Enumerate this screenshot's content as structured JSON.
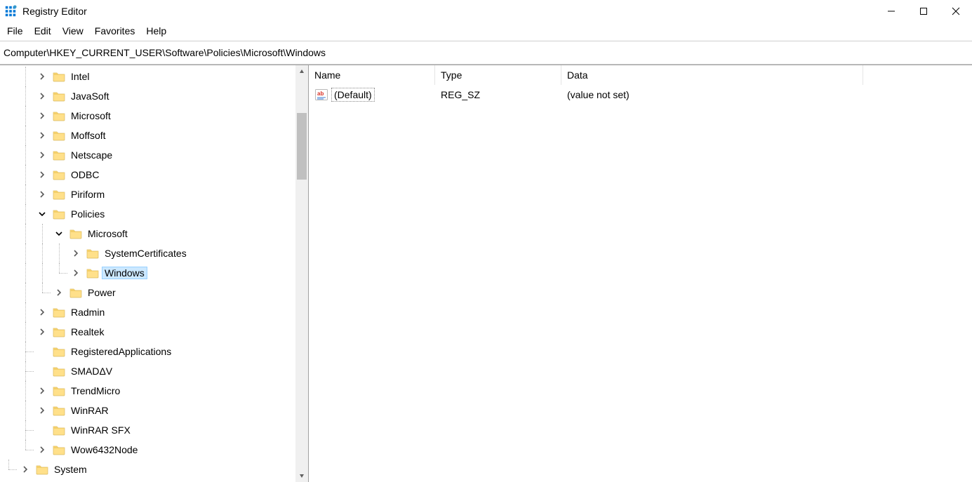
{
  "window": {
    "title": "Registry Editor"
  },
  "menu": {
    "items": [
      "File",
      "Edit",
      "View",
      "Favorites",
      "Help"
    ]
  },
  "address": {
    "path": "Computer\\HKEY_CURRENT_USER\\Software\\Policies\\Microsoft\\Windows"
  },
  "tree": {
    "items": [
      {
        "label": "Intel",
        "depth": 2,
        "glyph": "collapsed",
        "selected": false,
        "guides": [
          "blank",
          "vline"
        ],
        "last": false
      },
      {
        "label": "JavaSoft",
        "depth": 2,
        "glyph": "collapsed",
        "selected": false,
        "guides": [
          "blank",
          "vline"
        ],
        "last": false
      },
      {
        "label": "Microsoft",
        "depth": 2,
        "glyph": "collapsed",
        "selected": false,
        "guides": [
          "blank",
          "vline"
        ],
        "last": false
      },
      {
        "label": "Moffsoft",
        "depth": 2,
        "glyph": "collapsed",
        "selected": false,
        "guides": [
          "blank",
          "vline"
        ],
        "last": false
      },
      {
        "label": "Netscape",
        "depth": 2,
        "glyph": "collapsed",
        "selected": false,
        "guides": [
          "blank",
          "vline"
        ],
        "last": false
      },
      {
        "label": "ODBC",
        "depth": 2,
        "glyph": "collapsed",
        "selected": false,
        "guides": [
          "blank",
          "vline"
        ],
        "last": false
      },
      {
        "label": "Piriform",
        "depth": 2,
        "glyph": "collapsed",
        "selected": false,
        "guides": [
          "blank",
          "vline"
        ],
        "last": false
      },
      {
        "label": "Policies",
        "depth": 2,
        "glyph": "expanded",
        "selected": false,
        "guides": [
          "blank",
          "vline"
        ],
        "last": false
      },
      {
        "label": "Microsoft",
        "depth": 3,
        "glyph": "expanded",
        "selected": false,
        "guides": [
          "blank",
          "vline",
          "vline"
        ],
        "last": false
      },
      {
        "label": "SystemCertificates",
        "depth": 4,
        "glyph": "collapsed",
        "selected": false,
        "guides": [
          "blank",
          "vline",
          "vline",
          "vline"
        ],
        "last": false
      },
      {
        "label": "Windows",
        "depth": 4,
        "glyph": "collapsed",
        "selected": true,
        "guides": [
          "blank",
          "vline",
          "vline",
          "vline-top hline"
        ],
        "last": true
      },
      {
        "label": "Power",
        "depth": 3,
        "glyph": "collapsed",
        "selected": false,
        "guides": [
          "blank",
          "vline",
          "vline-top hline"
        ],
        "last": true
      },
      {
        "label": "Radmin",
        "depth": 2,
        "glyph": "collapsed",
        "selected": false,
        "guides": [
          "blank",
          "vline"
        ],
        "last": false
      },
      {
        "label": "Realtek",
        "depth": 2,
        "glyph": "collapsed",
        "selected": false,
        "guides": [
          "blank",
          "vline"
        ],
        "last": false
      },
      {
        "label": "RegisteredApplications",
        "depth": 2,
        "glyph": "none",
        "selected": false,
        "guides": [
          "blank",
          "vline hline"
        ],
        "last": false
      },
      {
        "label": "SMADΔV",
        "depth": 2,
        "glyph": "none",
        "selected": false,
        "guides": [
          "blank",
          "vline hline"
        ],
        "last": false
      },
      {
        "label": "TrendMicro",
        "depth": 2,
        "glyph": "collapsed",
        "selected": false,
        "guides": [
          "blank",
          "vline"
        ],
        "last": false
      },
      {
        "label": "WinRAR",
        "depth": 2,
        "glyph": "collapsed",
        "selected": false,
        "guides": [
          "blank",
          "vline"
        ],
        "last": false
      },
      {
        "label": "WinRAR SFX",
        "depth": 2,
        "glyph": "none",
        "selected": false,
        "guides": [
          "blank",
          "vline hline"
        ],
        "last": false
      },
      {
        "label": "Wow6432Node",
        "depth": 2,
        "glyph": "collapsed",
        "selected": false,
        "guides": [
          "blank",
          "vline-top hline"
        ],
        "last": true
      },
      {
        "label": "System",
        "depth": 1,
        "glyph": "collapsed",
        "selected": false,
        "guides": [
          "vline-top hline"
        ],
        "last": true
      }
    ]
  },
  "list": {
    "columns": {
      "name": "Name",
      "type": "Type",
      "data": "Data"
    },
    "rows": [
      {
        "name": "(Default)",
        "type": "REG_SZ",
        "data": "(value not set)",
        "icon": "ab",
        "focused": true
      }
    ]
  },
  "scrollbar": {
    "thumb_top_pct": 9,
    "thumb_height_pct": 17
  }
}
